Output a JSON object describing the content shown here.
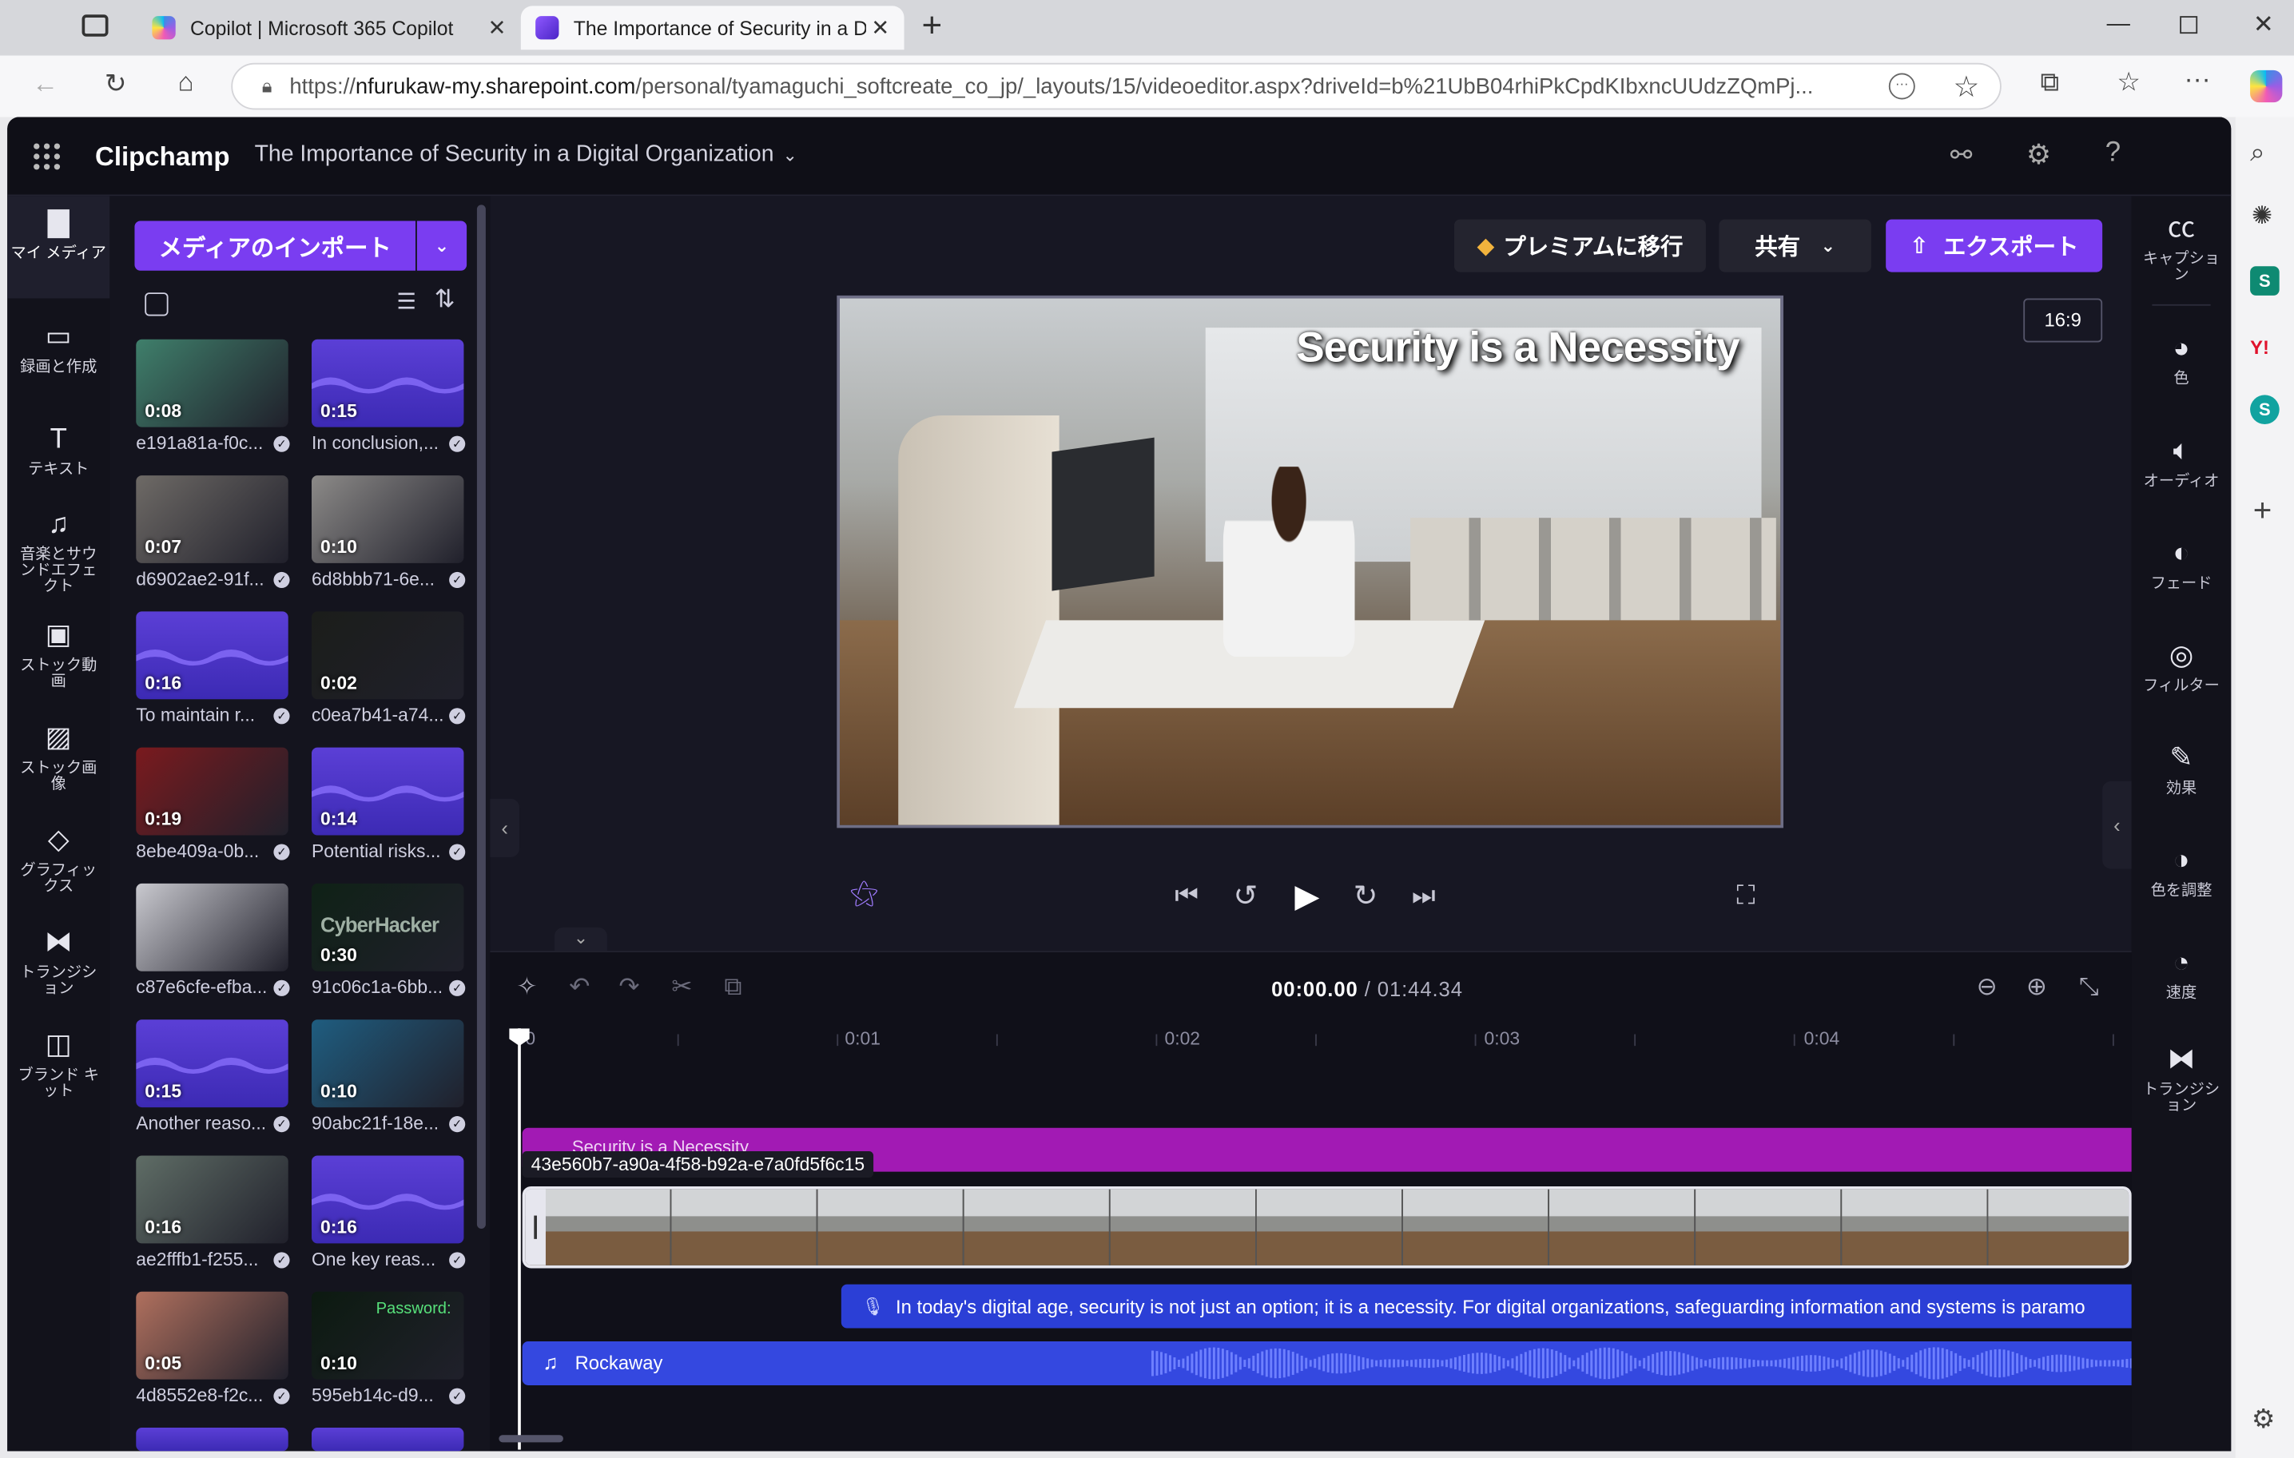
{
  "browser": {
    "tabs": [
      {
        "label": "Copilot | Microsoft 365 Copilot"
      },
      {
        "label": "The Importance of Security in a D"
      }
    ],
    "url_prefix": "https://",
    "url_host": "nfurukaw-my.sharepoint.com",
    "url_path": "/personal/tyamaguchi_softcreate_co_jp/_layouts/15/videoeditor.aspx?driveId=b%21UbB04rhiPkCpdKIbxncUUdzZQmPj..."
  },
  "app": {
    "name": "Clipchamp",
    "project_title": "The Importance of Security in a Digital Organization"
  },
  "left_rail": [
    {
      "label": "マイ メディア",
      "icon": "folder-icon"
    },
    {
      "label": "録画と作成",
      "icon": "camera-icon"
    },
    {
      "label": "テキスト",
      "icon": "text-icon"
    },
    {
      "label": "音楽とサウンドエフェクト",
      "icon": "music-icon"
    },
    {
      "label": "ストック動画",
      "icon": "film-icon"
    },
    {
      "label": "ストック画像",
      "icon": "image-icon"
    },
    {
      "label": "グラフィックス",
      "icon": "shapes-icon"
    },
    {
      "label": "トランジション",
      "icon": "transition-icon"
    },
    {
      "label": "ブランド キット",
      "icon": "brand-icon"
    }
  ],
  "media_panel": {
    "import_label": "メディアのインポート",
    "items": [
      {
        "duration": "0:08",
        "label": "e191a81a-f0c...",
        "kind": "video",
        "color": "#3f7f6b"
      },
      {
        "duration": "0:15",
        "label": "In conclusion,...",
        "kind": "audio",
        "color": "#4b34c8"
      },
      {
        "duration": "0:07",
        "label": "d6902ae2-91f...",
        "kind": "video",
        "color": "#6e6a66"
      },
      {
        "duration": "0:10",
        "label": "6d8bbb71-6e...",
        "kind": "video",
        "color": "#8c8a88"
      },
      {
        "duration": "0:16",
        "label": "To maintain r...",
        "kind": "audio",
        "color": "#4b34c8"
      },
      {
        "duration": "0:02",
        "label": "c0ea7b41-a74...",
        "kind": "video",
        "color": "#1b1d1a"
      },
      {
        "duration": "0:19",
        "label": "8ebe409a-0b...",
        "kind": "video",
        "color": "#7a1a1e"
      },
      {
        "duration": "0:14",
        "label": "Potential risks...",
        "kind": "audio",
        "color": "#4b34c8"
      },
      {
        "duration": "",
        "label": "c87e6cfe-efba...",
        "kind": "video",
        "color": "#c9c9cf"
      },
      {
        "duration": "0:30",
        "label": "91c06c1a-6bb...",
        "kind": "video",
        "color": "#0f2116"
      },
      {
        "duration": "0:15",
        "label": "Another reaso...",
        "kind": "audio",
        "color": "#4b34c8"
      },
      {
        "duration": "0:10",
        "label": "90abc21f-18e...",
        "kind": "video",
        "color": "#1f5d80"
      },
      {
        "duration": "0:16",
        "label": "ae2fffb1-f255...",
        "kind": "video",
        "color": "#5f6d66"
      },
      {
        "duration": "0:16",
        "label": "One key reas...",
        "kind": "audio",
        "color": "#4b34c8"
      },
      {
        "duration": "0:05",
        "label": "4d8552e8-f2c...",
        "kind": "video",
        "color": "#b0705e"
      },
      {
        "duration": "0:10",
        "label": "595eb14c-d9...",
        "kind": "video",
        "color": "#0c1a10"
      }
    ],
    "cyber_text": "CyberHacker",
    "password_text": "Password:"
  },
  "stage": {
    "premium_label": "プレミアムに移行",
    "share_label": "共有",
    "export_label": "エクスポート",
    "aspect": "16:9",
    "video_title": "Security is a Necessity"
  },
  "right_rail": [
    {
      "label": "キャプション",
      "icon": "captions-icon"
    },
    {
      "label": "色",
      "icon": "palette-icon"
    },
    {
      "label": "オーディオ",
      "icon": "speaker-icon"
    },
    {
      "label": "フェード",
      "icon": "fade-icon"
    },
    {
      "label": "フィルター",
      "icon": "filter-icon"
    },
    {
      "label": "効果",
      "icon": "wand-icon"
    },
    {
      "label": "色を調整",
      "icon": "contrast-icon"
    },
    {
      "label": "速度",
      "icon": "speed-icon"
    },
    {
      "label": "トランジション",
      "icon": "transition-icon"
    }
  ],
  "timeline": {
    "current_time": "00:00.00",
    "total_time": "/ 01:44.34",
    "ruler": [
      "0",
      "0:01",
      "0:02",
      "0:03",
      "0:04"
    ],
    "text_clip_label": "Security is a Necessity",
    "video_clip_label": "43e560b7-a90a-4f58-b92a-e7a0fd5f6c15",
    "caption_text": "In today's digital age, security is not just an option; it is a necessity. For digital organizations, safeguarding information and systems is paramo",
    "audio_label": "Rockaway"
  }
}
